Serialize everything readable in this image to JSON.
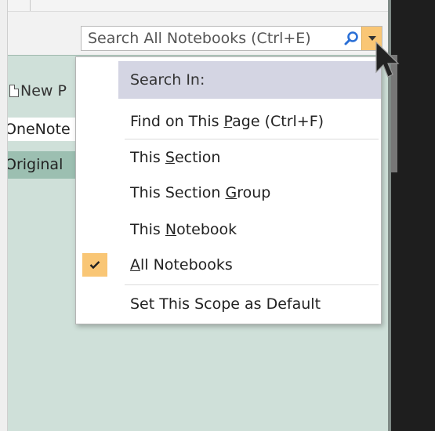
{
  "search": {
    "placeholder": "Search All Notebooks (Ctrl+E)"
  },
  "pages": {
    "new_page_label": "New P",
    "rows": [
      "OneNote",
      "Original"
    ]
  },
  "menu": {
    "header": "Search In:",
    "items": [
      {
        "prefix": "Find on This ",
        "accel": "P",
        "suffix": "age (Ctrl+F)",
        "checked": false
      },
      {
        "prefix": "This ",
        "accel": "S",
        "suffix": "ection",
        "checked": false
      },
      {
        "prefix": "This Section ",
        "accel": "G",
        "suffix": "roup",
        "checked": false
      },
      {
        "prefix": "This ",
        "accel": "N",
        "suffix": "otebook",
        "checked": false
      },
      {
        "prefix": "",
        "accel": "A",
        "suffix": "ll Notebooks",
        "checked": true
      },
      {
        "prefix": "Set This Scope as Default",
        "accel": "",
        "suffix": "",
        "checked": false
      }
    ]
  },
  "colors": {
    "accent_orange": "#f9c675",
    "menu_header_bg": "#d4d5e3",
    "page_pane_bg": "#cfe0d9",
    "selected_page_bg": "#9cbfb1"
  },
  "icons": {
    "search": "magnifier-icon",
    "dropdown": "chevron-down-icon",
    "check": "checkmark-icon",
    "cursor": "arrow-cursor-icon"
  }
}
